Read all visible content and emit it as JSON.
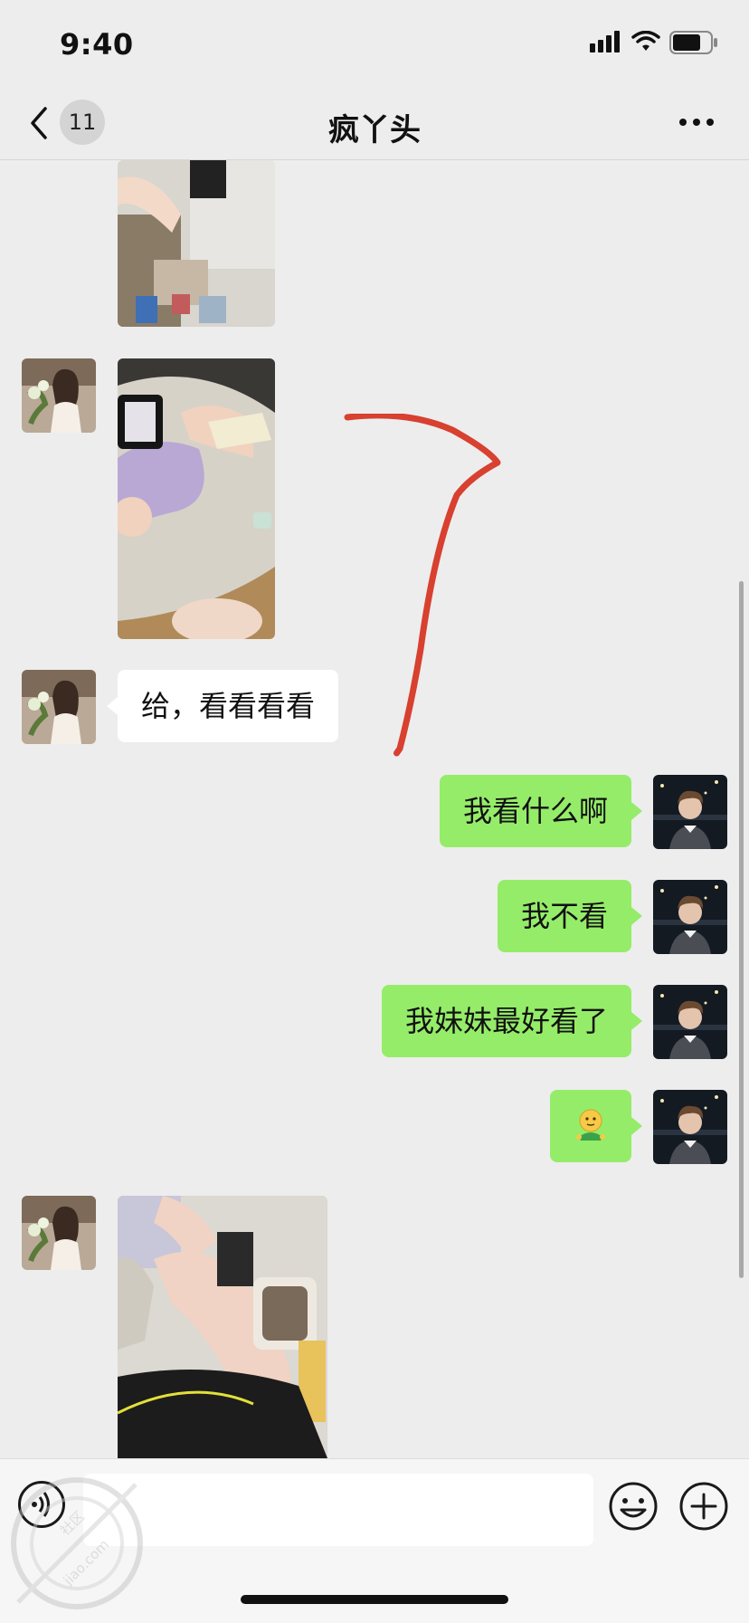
{
  "status_bar": {
    "time": "9:40"
  },
  "nav": {
    "back_count": "11",
    "title": "疯丫头"
  },
  "messages": {
    "m1": "给，看看看看",
    "m2": "我看什么啊",
    "m3": "我不看",
    "m4": "我妹妹最好看了",
    "m5": "🙂"
  },
  "input": {
    "placeholder": ""
  },
  "watermark": {
    "text": "jiao.com",
    "text2": "社区"
  },
  "colors": {
    "outgoing_bubble": "#95ec69",
    "incoming_bubble": "#ffffff",
    "annotation": "#d8402f"
  },
  "icons": [
    "chevron-left-icon",
    "more-icon",
    "voice-icon",
    "emoji-icon",
    "plus-icon",
    "signal-icon",
    "wifi-icon",
    "battery-icon"
  ]
}
